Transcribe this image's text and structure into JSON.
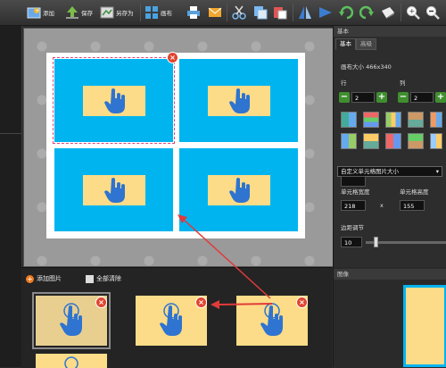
{
  "toolbar": {
    "add_label": "添加",
    "save_label": "保存",
    "saveas_label": "另存为",
    "canvas_label": "画布"
  },
  "right_panel": {
    "header": "基本",
    "tabs": [
      "基本",
      "高级"
    ],
    "canvas_size_label": "画布大小  466x340",
    "rows_label": "行",
    "cols_label": "列",
    "rows_value": "2",
    "cols_value": "2",
    "cell_size_option": "自定义单元格图片大小",
    "cell_width_label": "单元格宽度",
    "cell_height_label": "单元格高度",
    "cell_width_value": "218",
    "cell_height_value": "155",
    "times_sign": "x",
    "margin_label": "边距调节",
    "margin_value": "10",
    "margin_level": 0.1
  },
  "bottom": {
    "add_images_label": "添加图片",
    "clear_all_label": "全部清除"
  },
  "preview": {
    "header": "图像"
  },
  "colors": {
    "cell_blue": "#00b4f0",
    "cell_yellow": "#fcdc88",
    "hand_blue": "#2e74d0",
    "close_red": "#e0452f",
    "arrow_red": "#e03b3b"
  },
  "icons": [
    "add-icon",
    "save-icon",
    "saveas-icon",
    "canvas-icon",
    "print-icon",
    "mail-icon",
    "cut-icon",
    "copy-icon",
    "paste-icon",
    "flip-icon",
    "rotate-left-icon",
    "rotate-right-icon",
    "effect-icon",
    "zoom-in-icon",
    "zoom-out-icon",
    "fit-icon"
  ]
}
